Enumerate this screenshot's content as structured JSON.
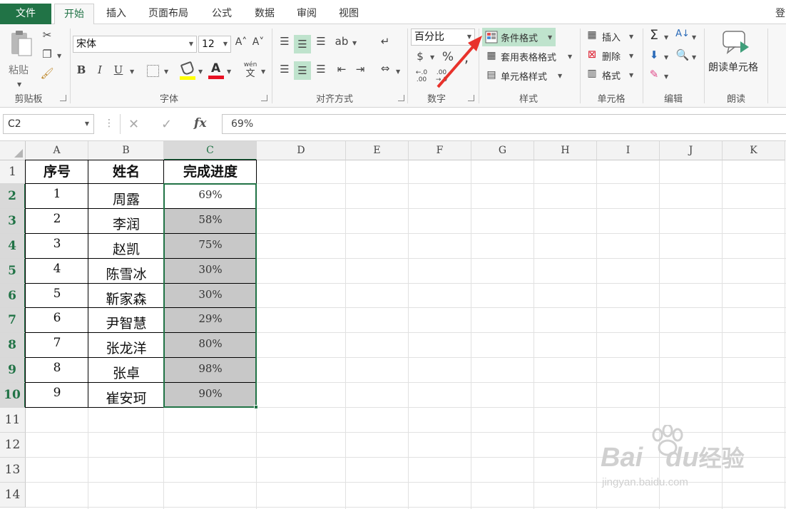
{
  "tabs": [
    {
      "label": "文件",
      "active": false,
      "file": true
    },
    {
      "label": "开始",
      "active": true
    },
    {
      "label": "插入"
    },
    {
      "label": "页面布局"
    },
    {
      "label": "公式"
    },
    {
      "label": "数据"
    },
    {
      "label": "审阅"
    },
    {
      "label": "视图"
    }
  ],
  "tab_overflow": "登",
  "ribbon": {
    "clipboard": {
      "label": "剪贴板",
      "paste": "粘贴"
    },
    "font": {
      "label": "字体",
      "name": "宋体",
      "size": "12",
      "bold": "B",
      "italic": "I",
      "underline": "U",
      "phonetic_top": "wén",
      "phonetic_bottom": "文"
    },
    "alignment": {
      "label": "对齐方式"
    },
    "number": {
      "label": "数字",
      "format": "百分比",
      "percent": "%",
      "comma": ","
    },
    "styles": {
      "label": "样式",
      "conditional": "条件格式",
      "table": "套用表格格式",
      "cell_styles": "单元格样式"
    },
    "cells": {
      "label": "单元格",
      "insert": "插入",
      "delete": "删除",
      "format": "格式"
    },
    "editing": {
      "label": "编辑",
      "sum": "Σ"
    },
    "read": {
      "label": "朗读",
      "button": "朗读单元格"
    }
  },
  "accent": "#217346",
  "highlight": "#bfe3cd",
  "annotation_color": "#e8322b",
  "formula_bar": {
    "name_box": "C2",
    "cancel": "✕",
    "confirm": "✓",
    "fx": "fx",
    "value": "69%"
  },
  "columns": [
    "A",
    "B",
    "C",
    "D",
    "E",
    "F",
    "G",
    "H",
    "I",
    "J",
    "K"
  ],
  "rows": [
    "1",
    "2",
    "3",
    "4",
    "5",
    "6",
    "7",
    "8",
    "9",
    "10",
    "11",
    "12",
    "13",
    "14"
  ],
  "table": {
    "headers": [
      "序号",
      "姓名",
      "完成进度"
    ],
    "records": [
      {
        "no": "1",
        "name": "周露",
        "progress": "69%"
      },
      {
        "no": "2",
        "name": "李润",
        "progress": "58%"
      },
      {
        "no": "3",
        "name": "赵凯",
        "progress": "75%"
      },
      {
        "no": "4",
        "name": "陈雪冰",
        "progress": "30%"
      },
      {
        "no": "5",
        "name": "靳家森",
        "progress": "30%"
      },
      {
        "no": "6",
        "name": "尹智慧",
        "progress": "29%"
      },
      {
        "no": "7",
        "name": "张龙洋",
        "progress": "80%"
      },
      {
        "no": "8",
        "name": "张卓",
        "progress": "98%"
      },
      {
        "no": "9",
        "name": "崔安珂",
        "progress": "90%"
      }
    ]
  },
  "watermark": {
    "brand": "Bai",
    "brand2": "du",
    "brand_cn": "经验",
    "url": "jingyan.baidu.com"
  }
}
